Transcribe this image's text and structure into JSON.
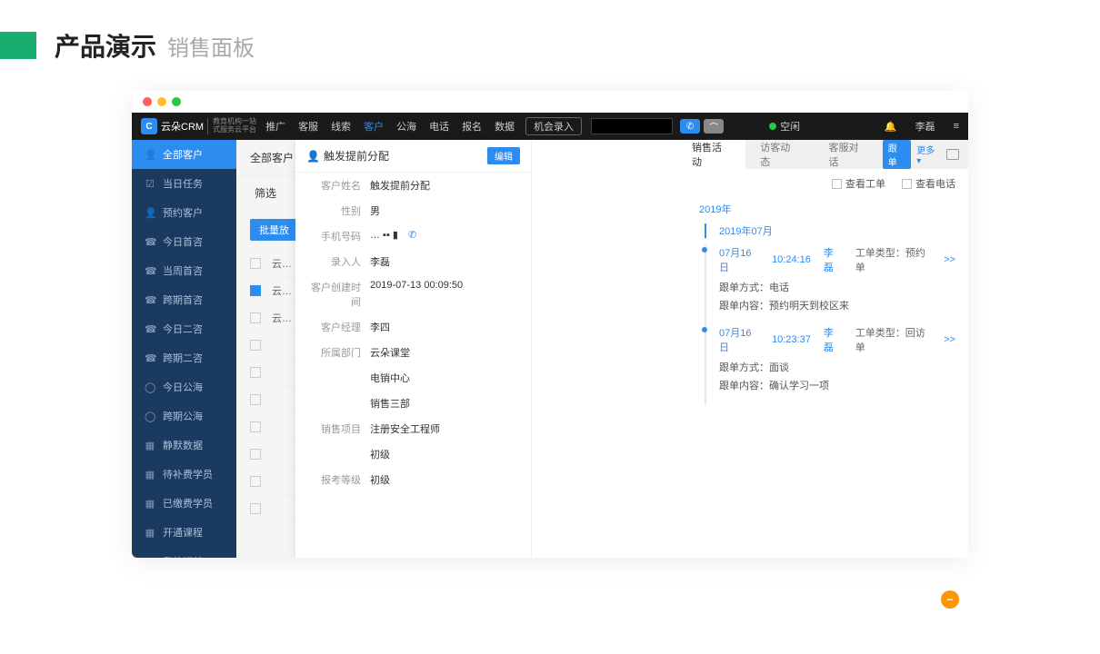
{
  "slide": {
    "title": "产品演示",
    "subtitle": "销售面板"
  },
  "topnav": {
    "logo": "云朵CRM",
    "logo_sub1": "教育机构一站",
    "logo_sub2": "式服务云平台",
    "items": [
      "推广",
      "客服",
      "线索",
      "客户",
      "公海",
      "电话",
      "报名",
      "数据"
    ],
    "active_index": 3,
    "opportunity": "机会录入",
    "status": "空闲",
    "user": "李磊"
  },
  "sidebar": {
    "items": [
      {
        "icon": "👤",
        "label": "全部客户"
      },
      {
        "icon": "☑",
        "label": "当日任务"
      },
      {
        "icon": "👤",
        "label": "预约客户"
      },
      {
        "icon": "☎",
        "label": "今日首咨"
      },
      {
        "icon": "☎",
        "label": "当周首咨"
      },
      {
        "icon": "☎",
        "label": "跨期首咨"
      },
      {
        "icon": "☎",
        "label": "今日二咨"
      },
      {
        "icon": "☎",
        "label": "跨期二咨"
      },
      {
        "icon": "◯",
        "label": "今日公海"
      },
      {
        "icon": "◯",
        "label": "跨期公海"
      },
      {
        "icon": "▦",
        "label": "静默数据"
      },
      {
        "icon": "▦",
        "label": "待补费学员"
      },
      {
        "icon": "▦",
        "label": "已缴费学员"
      },
      {
        "icon": "▦",
        "label": "开通课程"
      },
      {
        "icon": "▦",
        "label": "我的订单"
      }
    ],
    "active_index": 0
  },
  "content": {
    "header": "全部客户",
    "filter_label": "筛选",
    "bulk_btn": "批量放",
    "rows": [
      "云…",
      "云…",
      "云…",
      "",
      "",
      "",
      "",
      "",
      "",
      ""
    ]
  },
  "detail": {
    "header": "触发提前分配",
    "edit": "编辑",
    "fields": [
      {
        "label": "客户姓名",
        "value": "触发提前分配"
      },
      {
        "label": "性别",
        "value": "男"
      },
      {
        "label": "手机号码",
        "value": "… ▪▪ ▮",
        "phone": true
      },
      {
        "label": "录入人",
        "value": "李磊"
      },
      {
        "label": "客户创建时间",
        "value": "2019-07-13 00:09:50"
      },
      {
        "label": "客户经理",
        "value": "李四"
      },
      {
        "label": "所属部门",
        "value": "云朵课堂"
      },
      {
        "label": "",
        "value": "电销中心"
      },
      {
        "label": "",
        "value": "销售三部"
      },
      {
        "label": "销售项目",
        "value": "注册安全工程师"
      },
      {
        "label": "",
        "value": "初级"
      },
      {
        "label": "报考等级",
        "value": "初级"
      }
    ]
  },
  "activity": {
    "tabs": [
      "销售活动",
      "访客动态",
      "客服对话"
    ],
    "active_tab": 0,
    "follow_tag": "跟单",
    "more": "更多 ▾",
    "filters": [
      {
        "label": "查看工单"
      },
      {
        "label": "查看电话"
      }
    ],
    "year": "2019年",
    "month": "2019年07月",
    "entries": [
      {
        "date": "07月16日",
        "time": "10:24:16",
        "user": "李磊",
        "type_label": "工单类型：",
        "type_value": "预约单",
        "lines": [
          {
            "k": "跟单方式：",
            "v": "电话"
          },
          {
            "k": "跟单内容：",
            "v": "预约明天到校区来"
          }
        ],
        "arrow": ">>"
      },
      {
        "date": "07月16日",
        "time": "10:23:37",
        "user": "李磊",
        "type_label": "工单类型：",
        "type_value": "回访单",
        "lines": [
          {
            "k": "跟单方式：",
            "v": "面谈"
          },
          {
            "k": "跟单内容：",
            "v": "确认学习一项"
          }
        ],
        "arrow": ">>"
      }
    ]
  }
}
